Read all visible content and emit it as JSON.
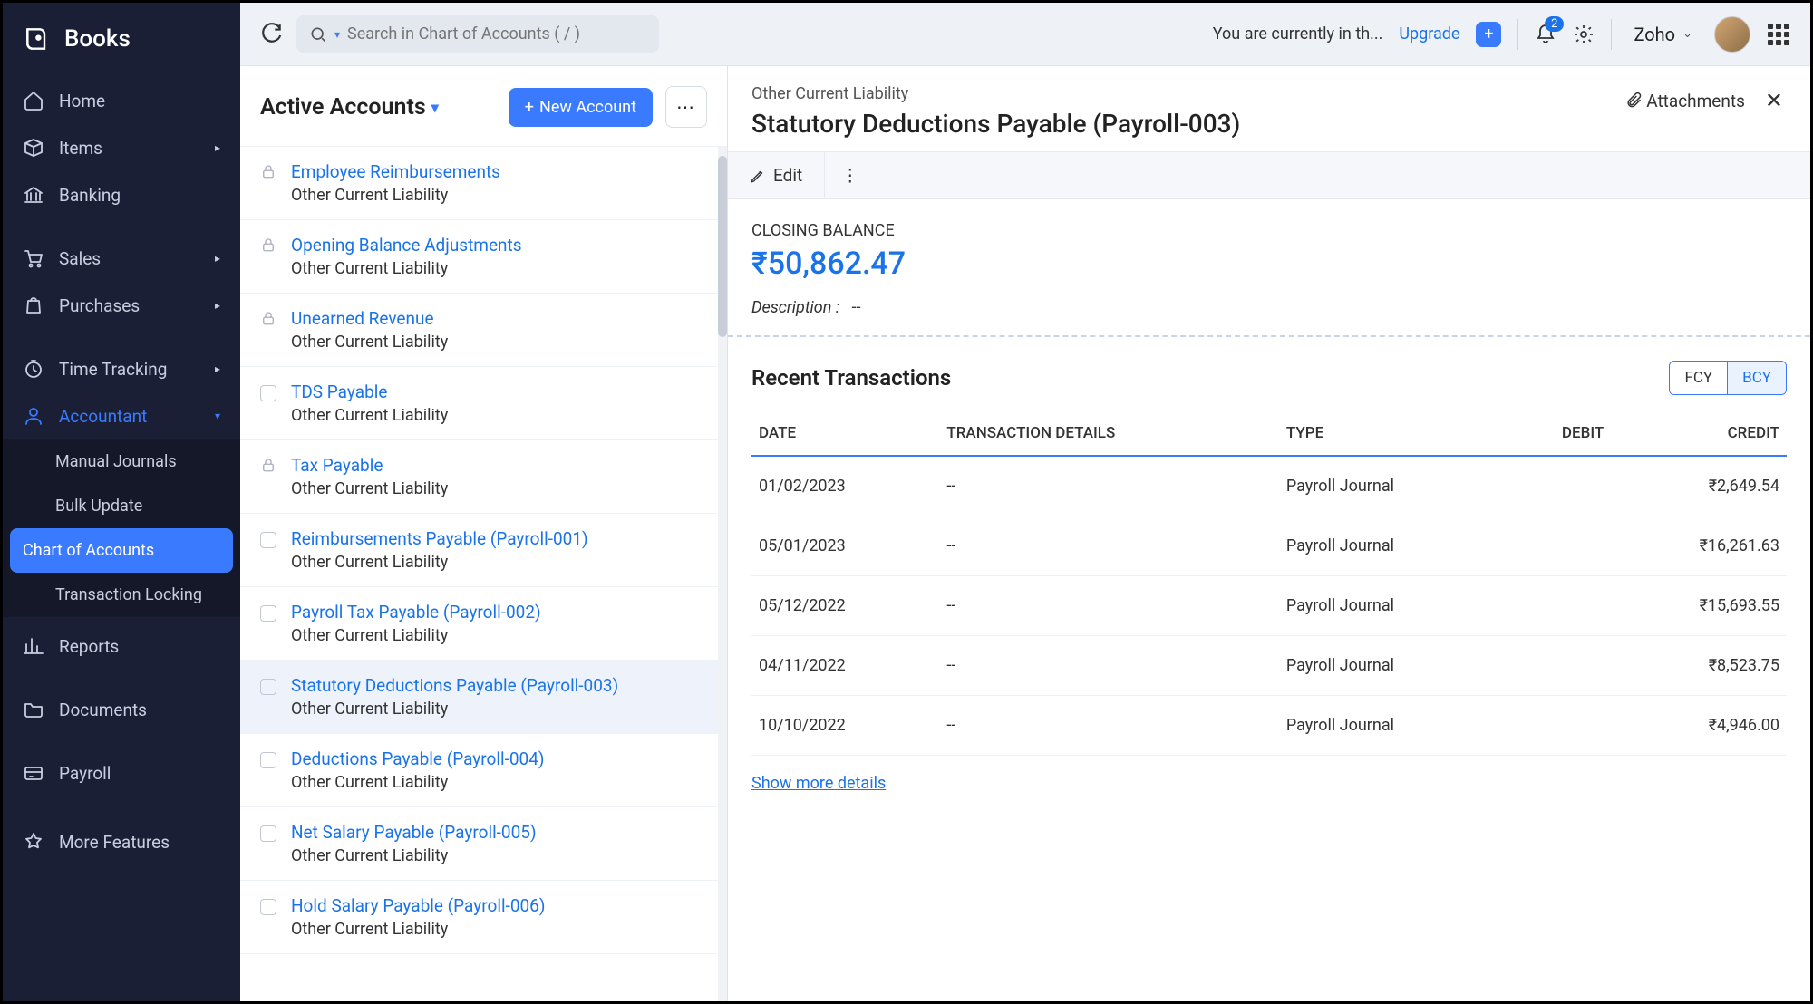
{
  "app_name": "Books",
  "topbar": {
    "search_placeholder": "Search in Chart of Accounts ( / )",
    "trial_text": "You are currently in th...",
    "upgrade": "Upgrade",
    "notification_count": "2",
    "org_name": "Zoho"
  },
  "sidebar": {
    "items": [
      {
        "icon": "home",
        "label": "Home"
      },
      {
        "icon": "box",
        "label": "Items",
        "expandable": true
      },
      {
        "icon": "bank",
        "label": "Banking"
      },
      {
        "icon": "cart",
        "label": "Sales",
        "expandable": true
      },
      {
        "icon": "bag",
        "label": "Purchases",
        "expandable": true
      },
      {
        "icon": "clock",
        "label": "Time Tracking",
        "expandable": true
      },
      {
        "icon": "user",
        "label": "Accountant",
        "expandable": true,
        "expanded": true,
        "children": [
          {
            "label": "Manual Journals"
          },
          {
            "label": "Bulk Update"
          },
          {
            "label": "Chart of Accounts",
            "active": true
          },
          {
            "label": "Transaction Locking"
          }
        ]
      },
      {
        "icon": "chart",
        "label": "Reports"
      },
      {
        "icon": "folder",
        "label": "Documents"
      },
      {
        "icon": "payroll",
        "label": "Payroll"
      },
      {
        "icon": "star",
        "label": "More Features"
      }
    ]
  },
  "list": {
    "title": "Active Accounts",
    "new_button": "New Account",
    "accounts": [
      {
        "name": "Employee Reimbursements",
        "type": "Other Current Liability",
        "locked": true
      },
      {
        "name": "Opening Balance Adjustments",
        "type": "Other Current Liability",
        "locked": true
      },
      {
        "name": "Unearned Revenue",
        "type": "Other Current Liability",
        "locked": true
      },
      {
        "name": "TDS Payable",
        "type": "Other Current Liability",
        "locked": false
      },
      {
        "name": "Tax Payable",
        "type": "Other Current Liability",
        "locked": true
      },
      {
        "name": "Reimbursements Payable (Payroll-001)",
        "type": "Other Current Liability",
        "locked": false
      },
      {
        "name": "Payroll Tax Payable (Payroll-002)",
        "type": "Other Current Liability",
        "locked": false
      },
      {
        "name": "Statutory Deductions Payable (Payroll-003)",
        "type": "Other Current Liability",
        "locked": false,
        "selected": true
      },
      {
        "name": "Deductions Payable (Payroll-004)",
        "type": "Other Current Liability",
        "locked": false
      },
      {
        "name": "Net Salary Payable (Payroll-005)",
        "type": "Other Current Liability",
        "locked": false
      },
      {
        "name": "Hold Salary Payable (Payroll-006)",
        "type": "Other Current Liability",
        "locked": false
      }
    ]
  },
  "detail": {
    "crumb": "Other Current Liability",
    "title": "Statutory Deductions Payable (Payroll-003)",
    "attachments": "Attachments",
    "edit": "Edit",
    "closing_label": "CLOSING BALANCE",
    "closing_value": "₹50,862.47",
    "description_label": "Description :",
    "description_value": "--",
    "tx_title": "Recent Transactions",
    "fcy": "FCY",
    "bcy": "BCY",
    "columns": {
      "date": "DATE",
      "details": "TRANSACTION DETAILS",
      "type": "TYPE",
      "debit": "DEBIT",
      "credit": "CREDIT"
    },
    "transactions": [
      {
        "date": "01/02/2023",
        "details": "--",
        "type": "Payroll Journal",
        "debit": "",
        "credit": "₹2,649.54"
      },
      {
        "date": "05/01/2023",
        "details": "--",
        "type": "Payroll Journal",
        "debit": "",
        "credit": "₹16,261.63"
      },
      {
        "date": "05/12/2022",
        "details": "--",
        "type": "Payroll Journal",
        "debit": "",
        "credit": "₹15,693.55"
      },
      {
        "date": "04/11/2022",
        "details": "--",
        "type": "Payroll Journal",
        "debit": "",
        "credit": "₹8,523.75"
      },
      {
        "date": "10/10/2022",
        "details": "--",
        "type": "Payroll Journal",
        "debit": "",
        "credit": "₹4,946.00"
      }
    ],
    "show_more": "Show more details"
  }
}
